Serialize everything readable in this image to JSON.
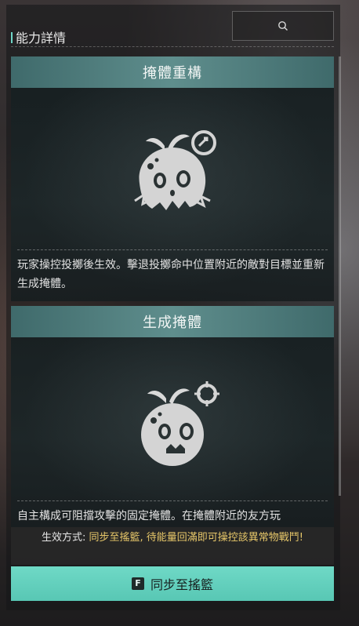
{
  "header": {
    "title": "能力詳情",
    "search_icon": "search-icon"
  },
  "cards": [
    {
      "title": "掩體重構",
      "icon": "cover-rebuild-icon",
      "description": "玩家操控投擲後生效。擊退投擲命中位置附近的敵對目標並重新生成掩體。"
    },
    {
      "title": "生成掩體",
      "icon": "cover-spawn-icon",
      "description": "自主構成可阻擋攻擊的固定掩體。在掩體附近的友方玩"
    }
  ],
  "effect": {
    "label": "生效方式:",
    "text": "同步至搖籃, 待能量回滿即可操控該異常物戰鬥!"
  },
  "action_button": {
    "key": "F",
    "label": "同步至搖籃"
  },
  "colors": {
    "accent": "#6ed6c8",
    "title_bar": "#5f8e8d",
    "effect_text": "#e8c86a",
    "button": "#62cfbc"
  }
}
